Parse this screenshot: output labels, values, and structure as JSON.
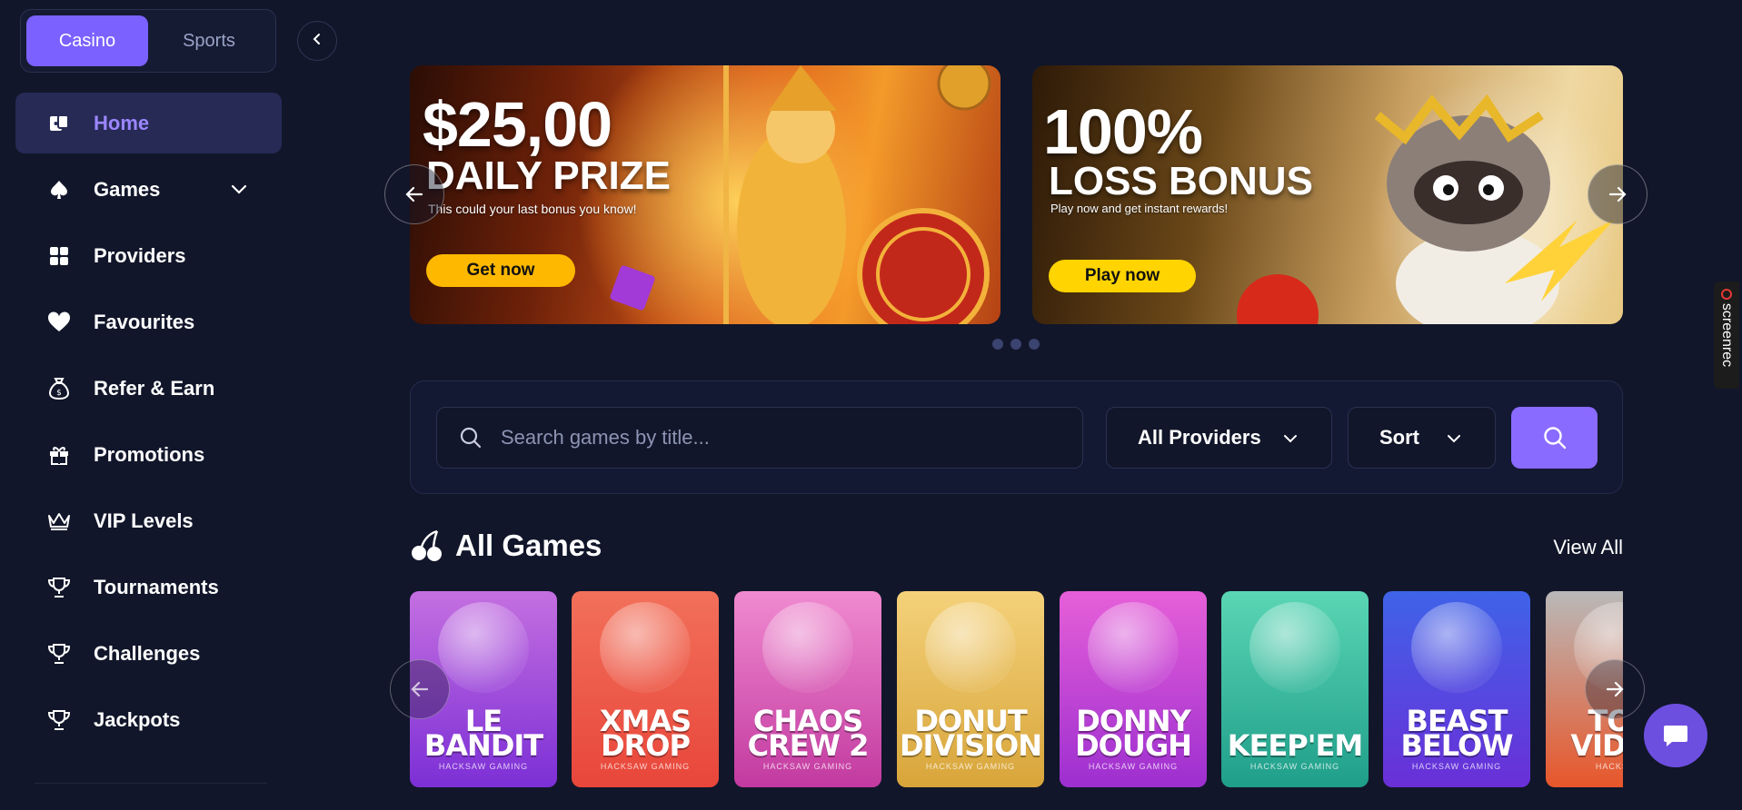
{
  "sidebar": {
    "tabs": [
      {
        "label": "Casino",
        "active": true
      },
      {
        "label": "Sports",
        "active": false
      }
    ],
    "items": [
      {
        "label": "Home",
        "icon": "home-cards-icon",
        "active": true
      },
      {
        "label": "Games",
        "icon": "spade-icon",
        "has_submenu": true
      },
      {
        "label": "Providers",
        "icon": "grid-icon"
      },
      {
        "label": "Favourites",
        "icon": "heart-icon"
      },
      {
        "label": "Refer & Earn",
        "icon": "money-bag-icon"
      },
      {
        "label": "Promotions",
        "icon": "gift-icon"
      },
      {
        "label": "VIP Levels",
        "icon": "crown-icon"
      },
      {
        "label": "Tournaments",
        "icon": "trophy-icon"
      },
      {
        "label": "Challenges",
        "icon": "trophy-icon"
      },
      {
        "label": "Jackpots",
        "icon": "trophy-icon"
      }
    ]
  },
  "banners": [
    {
      "headline": "$25,00",
      "subheadline": "DAILY PRIZE",
      "text": "This could your last bonus you know!",
      "cta": "Get now"
    },
    {
      "headline": "100%",
      "subheadline": "LOSS BONUS",
      "text": "Play now and get instant rewards!",
      "cta": "Play now"
    }
  ],
  "carousel": {
    "dots": 3
  },
  "search": {
    "placeholder": "Search games by title...",
    "providers_label": "All Providers",
    "sort_label": "Sort"
  },
  "games_section": {
    "title": "All Games",
    "view_all": "View All",
    "games": [
      {
        "title_line1": "LE",
        "title_line2": "BANDIT",
        "maker": "HACKSAW GAMING",
        "color_top": "#c46fe0",
        "color_bottom": "#7c2fd6"
      },
      {
        "title_line1": "XMAS",
        "title_line2": "DROP",
        "maker": "HACKSAW GAMING",
        "color_top": "#f2705a",
        "color_bottom": "#e8463a"
      },
      {
        "title_line1": "CHAOS",
        "title_line2": "CREW 2",
        "maker": "HACKSAW GAMING",
        "color_top": "#f08ad0",
        "color_bottom": "#c23aa0"
      },
      {
        "title_line1": "DONUT",
        "title_line2": "DIVISION",
        "maker": "HACKSAW GAMING",
        "color_top": "#f4d17a",
        "color_bottom": "#d8a53a"
      },
      {
        "title_line1": "DONNY",
        "title_line2": "DOUGH",
        "maker": "HACKSAW GAMING",
        "color_top": "#e65fd8",
        "color_bottom": "#9d2fd0"
      },
      {
        "title_line1": "KEEP'EM",
        "title_line2": "",
        "maker": "HACKSAW GAMING",
        "color_top": "#5ad6b4",
        "color_bottom": "#1f9e8a"
      },
      {
        "title_line1": "BEAST",
        "title_line2": "BELOW",
        "maker": "HACKSAW GAMING",
        "color_top": "#3f63e8",
        "color_bottom": "#6a2fd8"
      },
      {
        "title_line1": "TOS",
        "title_line2": "VIDEO",
        "maker": "HACKSAW",
        "color_top": "#b9b9b9",
        "color_bottom": "#e8562a"
      }
    ]
  },
  "overlay": {
    "screenrec_label": "screenrec"
  },
  "colors": {
    "accent": "#7b61ff",
    "background": "#11162a",
    "cta_yellow": "#ffb800"
  }
}
